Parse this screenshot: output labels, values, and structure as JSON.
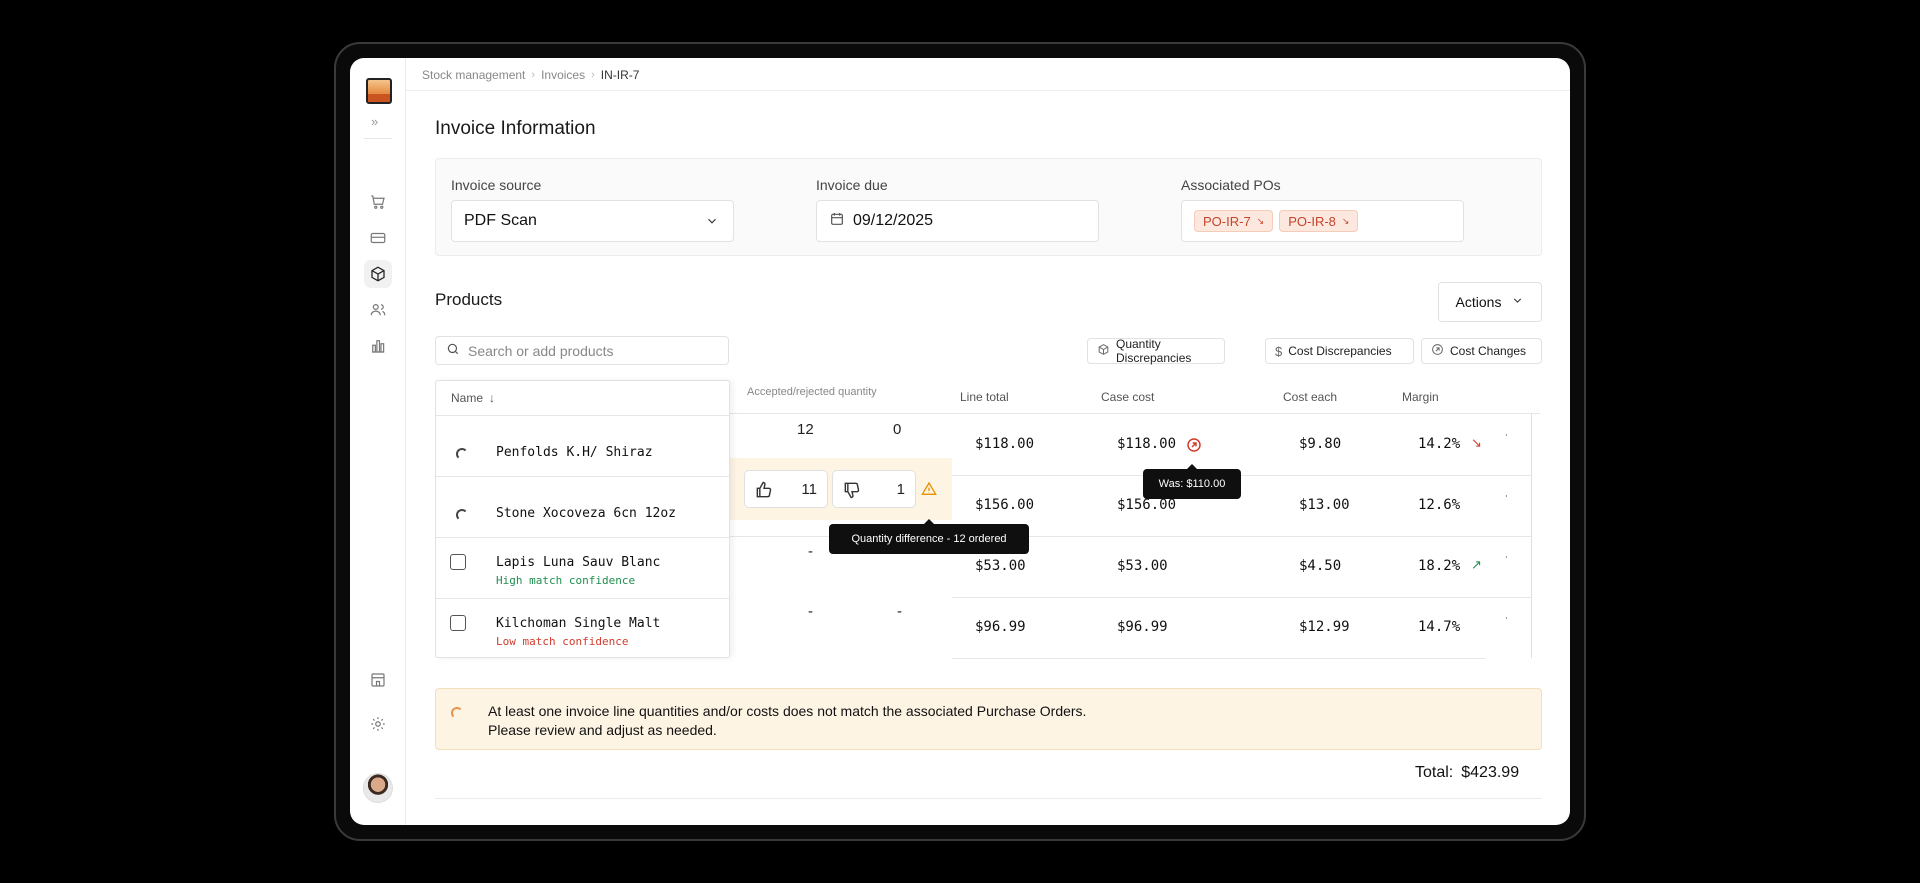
{
  "breadcrumb": [
    "Stock management",
    "Invoices",
    "IN-IR-7"
  ],
  "section_title": "Invoice Information",
  "invoice_source": {
    "label": "Invoice source",
    "value": "PDF Scan"
  },
  "invoice_due": {
    "label": "Invoice due",
    "value": "09/12/2025"
  },
  "associated_pos": {
    "label": "Associated POs",
    "chips": [
      "PO-IR-7",
      "PO-IR-8"
    ]
  },
  "products": {
    "title": "Products",
    "actions_label": "Actions",
    "search_placeholder": "Search or add products",
    "filters": [
      "Quantity Discrepancies",
      "Cost Discrepancies",
      "Cost Changes"
    ],
    "columns": {
      "name": "Name",
      "qty": "Accepted/rejected quantity",
      "line_total": "Line total",
      "case_cost": "Case cost",
      "cost_each": "Cost each",
      "margin": "Margin"
    },
    "rows": [
      {
        "name": "Penfolds K.H/ Shiraz",
        "confidence": "",
        "accepted": "12",
        "rejected": "0",
        "line_total": "$118.00",
        "case_cost": "$118.00",
        "cost_each": "$9.80",
        "margin": "14.2%",
        "trend": "↘"
      },
      {
        "name": "Stone Xocoveza 6cn 12oz",
        "confidence": "",
        "accepted": "11",
        "rejected": "1",
        "line_total": "$156.00",
        "case_cost": "$156.00",
        "cost_each": "$13.00",
        "margin": "12.6%",
        "trend": ""
      },
      {
        "name": "Lapis Luna Sauv Blanc",
        "confidence": "High match confidence",
        "accepted": "-",
        "rejected": "",
        "line_total": "$53.00",
        "case_cost": "$53.00",
        "cost_each": "$4.50",
        "margin": "18.2%",
        "trend": "↗"
      },
      {
        "name": "Kilchoman Single Malt",
        "confidence": "Low match confidence",
        "accepted": "-",
        "rejected": "-",
        "line_total": "$96.99",
        "case_cost": "$96.99",
        "cost_each": "$12.99",
        "margin": "14.7%",
        "trend": ""
      }
    ],
    "tooltip_cost": "Was: $110.00",
    "tooltip_qty": "Quantity difference - 12 ordered"
  },
  "alert": {
    "line1": "At least one invoice line quantities and/or costs does not match the associated Purchase Orders.",
    "line2": "Please review and adjust as needed."
  },
  "total": {
    "label": "Total:",
    "value": "$423.99"
  },
  "colors": {
    "accent": "#e8924a",
    "warning_bg": "#fdf4e4",
    "chip_text": "#c4432a",
    "positive": "#1f8f4e",
    "negative": "#d23b2c"
  }
}
